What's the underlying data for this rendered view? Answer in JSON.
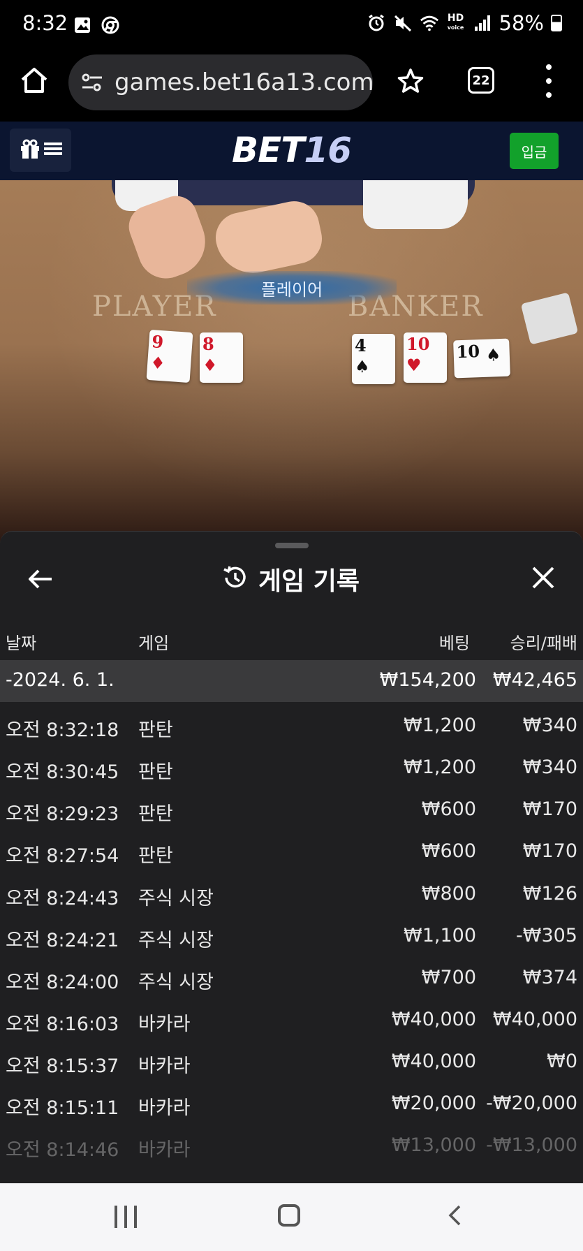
{
  "status_bar": {
    "time": "8:32",
    "battery": "58%",
    "left_icons": [
      "image-icon",
      "chrome-icon"
    ],
    "right_icons": [
      "alarm-icon",
      "mute-icon",
      "wifi-icon",
      "hd-voice-icon",
      "signal-icon",
      "battery-icon"
    ]
  },
  "browser": {
    "url": "games.bet16a13.com/",
    "tab_count": "22"
  },
  "site_header": {
    "logo_part1": "BET",
    "logo_part2": "16",
    "deposit_label": "입금"
  },
  "game_view": {
    "result_banner": "플레이어",
    "player_label": "PLAYER",
    "banker_label": "BANKER",
    "player_cards": [
      {
        "rank": "9",
        "suit": "♦",
        "color": "red"
      },
      {
        "rank": "8",
        "suit": "♦",
        "color": "red"
      }
    ],
    "banker_cards": [
      {
        "rank": "4",
        "suit": "♠",
        "color": "black"
      },
      {
        "rank": "10",
        "suit": "♥",
        "color": "red"
      },
      {
        "rank": "10",
        "suit": "♠",
        "color": "black"
      }
    ]
  },
  "history_panel": {
    "title": "게임 기록",
    "columns": {
      "date": "날짜",
      "game": "게임",
      "bet": "베팅",
      "win_loss": "승리/패배"
    },
    "date_group": {
      "date": "-2024. 6. 1.",
      "total_bet": "₩154,200",
      "total_win": "₩42,465"
    },
    "rows": [
      {
        "time": "오전 8:32:18",
        "game": "판탄",
        "bet": "₩1,200",
        "result": "₩340"
      },
      {
        "time": "오전 8:30:45",
        "game": "판탄",
        "bet": "₩1,200",
        "result": "₩340"
      },
      {
        "time": "오전 8:29:23",
        "game": "판탄",
        "bet": "₩600",
        "result": "₩170"
      },
      {
        "time": "오전 8:27:54",
        "game": "판탄",
        "bet": "₩600",
        "result": "₩170"
      },
      {
        "time": "오전 8:24:43",
        "game": "주식 시장",
        "bet": "₩800",
        "result": "₩126"
      },
      {
        "time": "오전 8:24:21",
        "game": "주식 시장",
        "bet": "₩1,100",
        "result": "-₩305"
      },
      {
        "time": "오전 8:24:00",
        "game": "주식 시장",
        "bet": "₩700",
        "result": "₩374"
      },
      {
        "time": "오전 8:16:03",
        "game": "바카라",
        "bet": "₩40,000",
        "result": "₩40,000"
      },
      {
        "time": "오전 8:15:37",
        "game": "바카라",
        "bet": "₩40,000",
        "result": "₩0"
      },
      {
        "time": "오전 8:15:11",
        "game": "바카라",
        "bet": "₩20,000",
        "result": "-₩20,000"
      },
      {
        "time": "오전 8:14:46",
        "game": "바카라",
        "bet": "₩13,000",
        "result": "-₩13,000"
      }
    ]
  },
  "colors": {
    "site_header_bg": "#0b1530",
    "deposit_green": "#12a12b",
    "panel_bg": "#1f1f21",
    "date_row_bg": "#3a3a3c"
  }
}
